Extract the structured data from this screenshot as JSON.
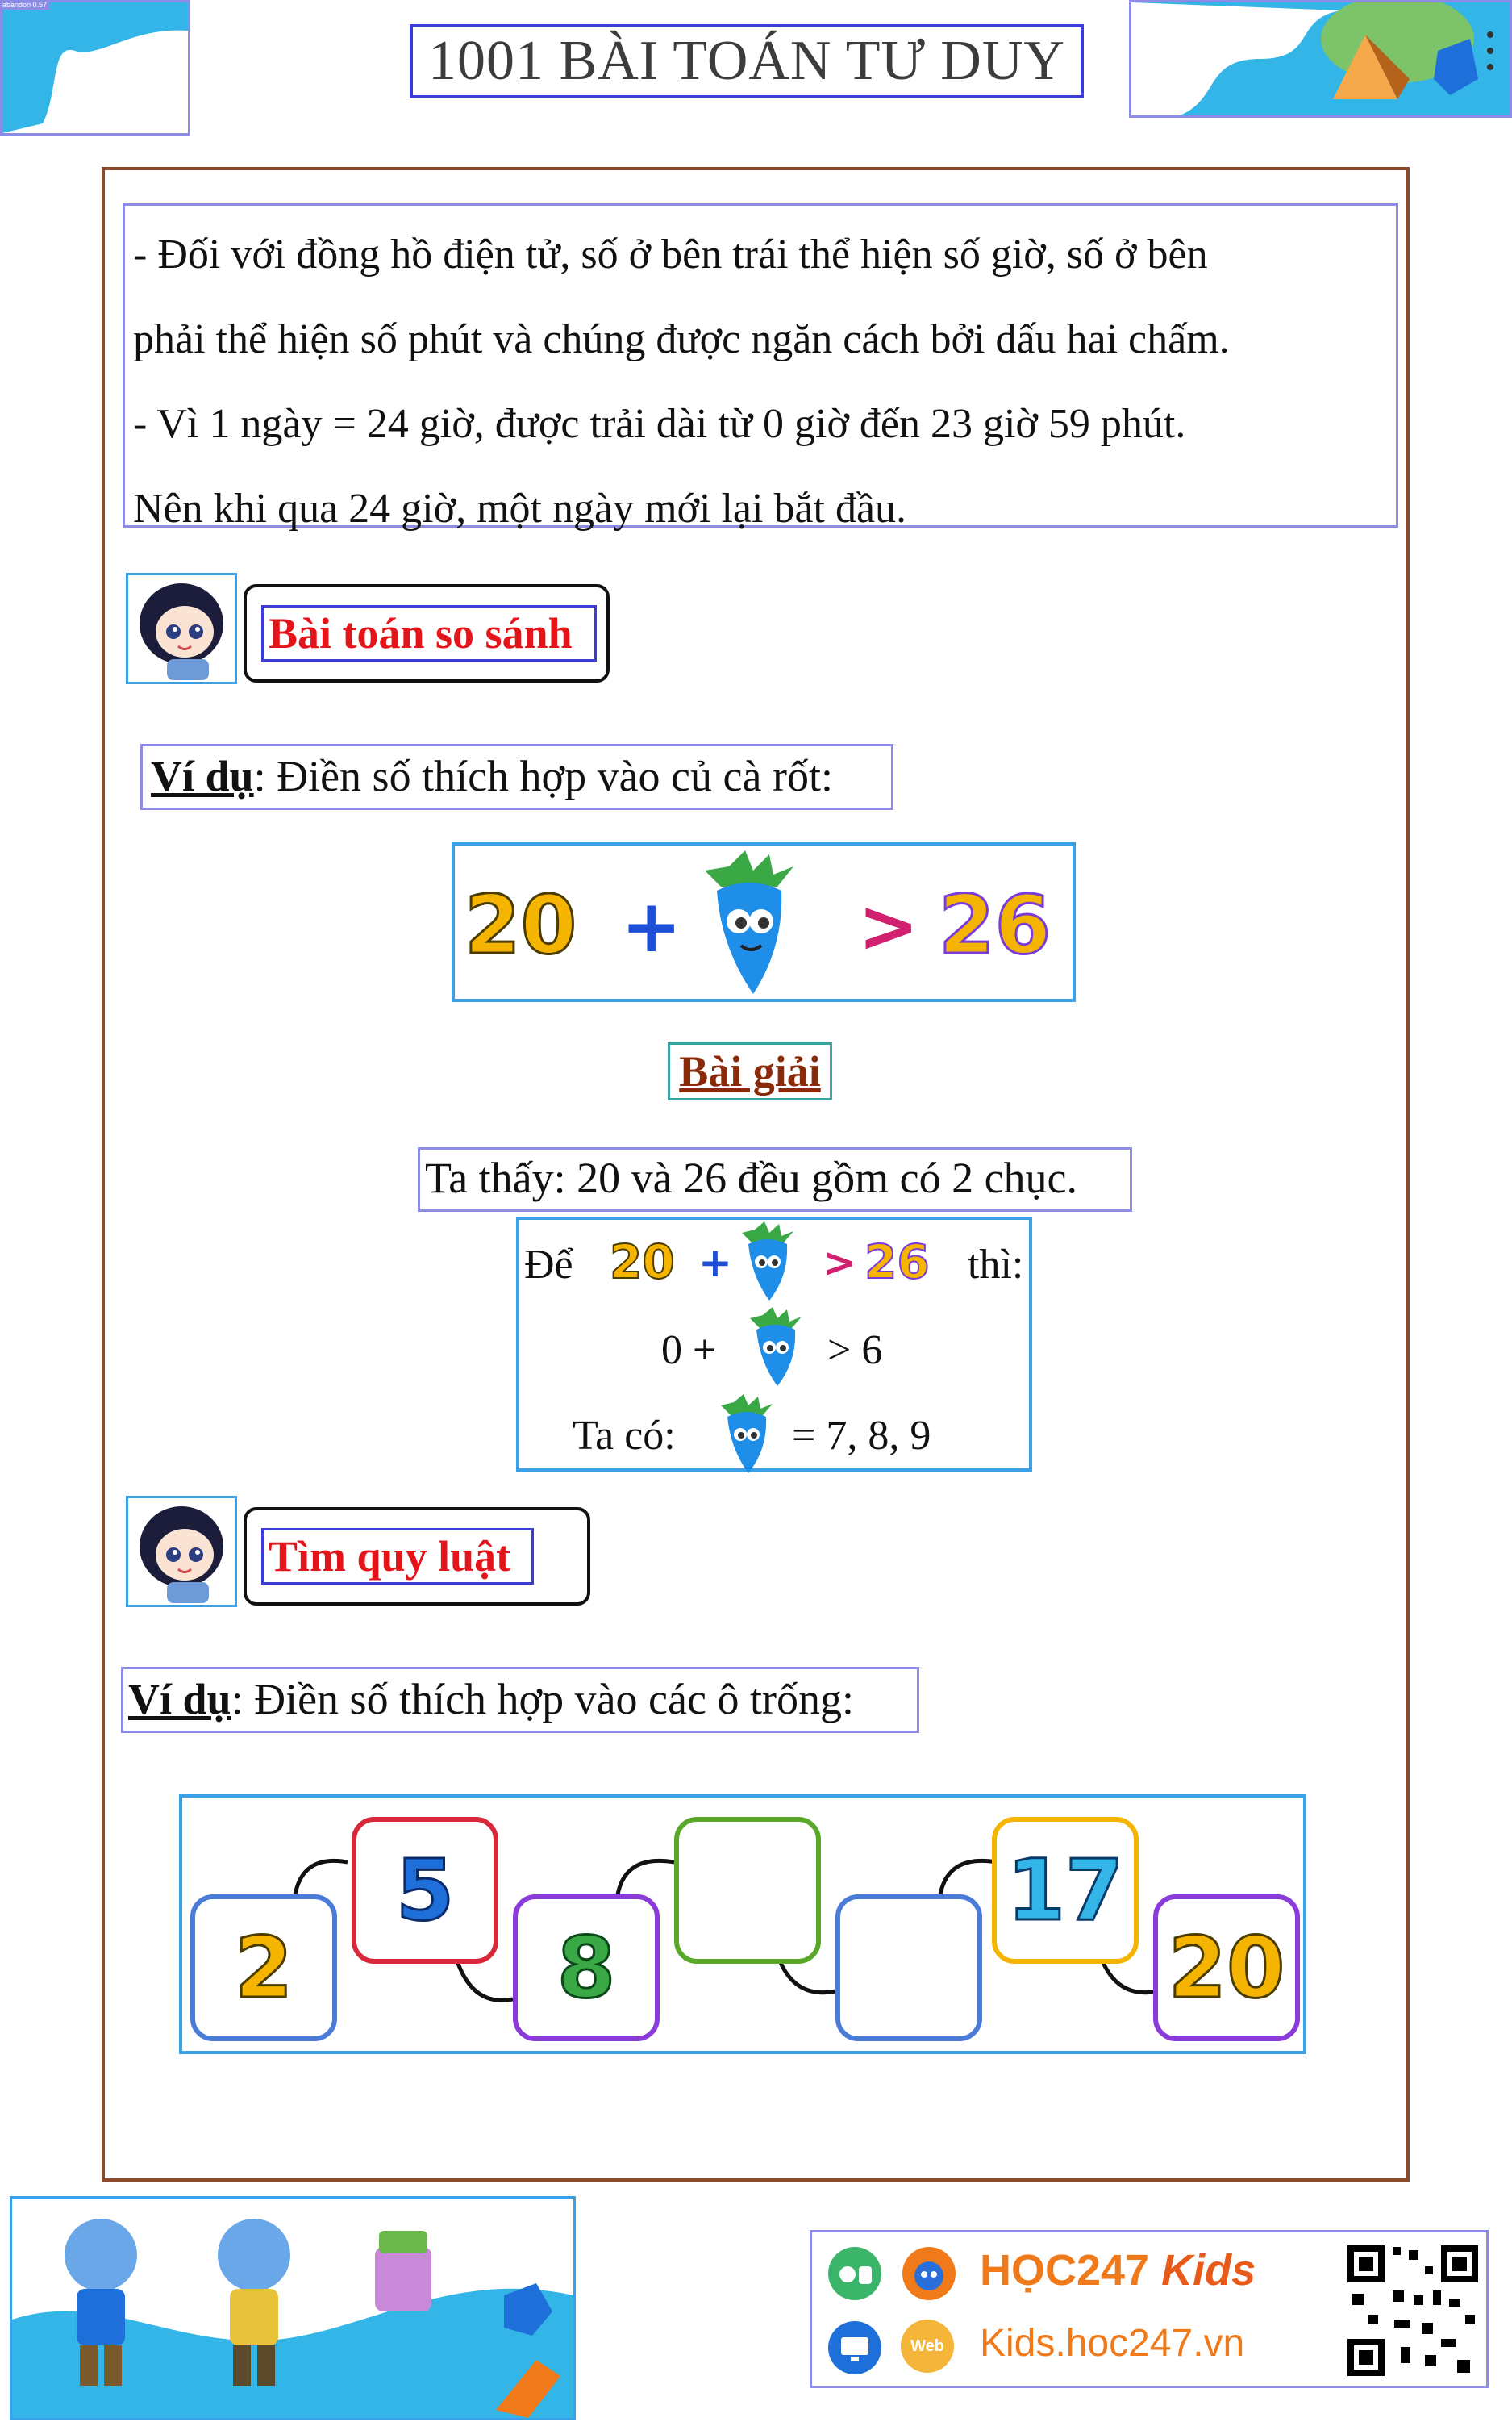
{
  "header": {
    "title": "1001 BÀI TOÁN TƯ DUY"
  },
  "intro": {
    "line1": "- Đối với đồng hồ điện tử, số ở bên trái thể hiện số giờ, số ở bên",
    "line2": "phải thể hiện số phút và chúng được ngăn cách bởi dấu hai chấm.",
    "line3": "- Vì 1 ngày = 24 giờ, được trải dài từ 0 giờ đến 23 giờ 59 phút.",
    "line4": "Nên khi qua 24 giờ, một ngày mới lại bắt đầu."
  },
  "section1": {
    "title": "Bài toán so sánh",
    "example_label": "Ví dụ",
    "example_text": ": Điền số thích hợp vào củ cà rốt:",
    "equation": {
      "a": "20",
      "op": "+",
      "cmp": ">",
      "b": "26"
    },
    "solution_title": "Bài giải",
    "solution_intro": "Ta thấy: 20 và 26 đều gồm có 2 chục.",
    "step1_prefix": "Để",
    "step1_a": "20",
    "step1_op": "+",
    "step1_cmp": ">",
    "step1_b": "26",
    "step1_suffix": "thì:",
    "step2_prefix": "0 +",
    "step2_suffix": "> 6",
    "step3_prefix": "Ta có:",
    "step3_suffix": "= 7, 8, 9"
  },
  "section2": {
    "title": "Tìm quy luật",
    "example_label": "Ví dụ",
    "example_text": ": Điền số thích hợp vào các ô trống:",
    "sequence": [
      "2",
      "5",
      "8",
      "",
      "",
      "17",
      "20"
    ]
  },
  "footer": {
    "brand": "HỌC247",
    "brand_suffix": "Kids",
    "website": "Kids.hoc247.vn",
    "web_badge": "Web"
  },
  "colors": {
    "title_border": "#3b3bd6",
    "frame_border": "#8b4a2b",
    "section_title": "#e4141b",
    "solution_title": "#8b2a0a",
    "brand_orange": "#f07a1a"
  }
}
